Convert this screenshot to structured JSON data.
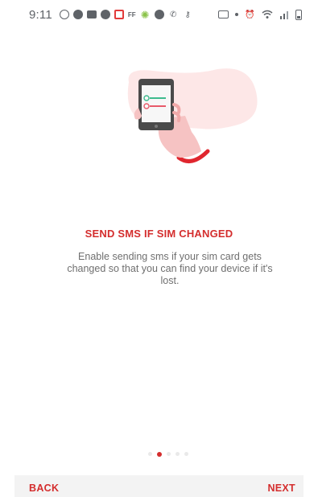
{
  "status_bar": {
    "time": "9:11",
    "left_icons": [
      "whatsapp-icon",
      "messenger-icon",
      "book-icon",
      "facebook-icon",
      "notification-square-icon",
      "ff-icon",
      "gear-icon",
      "messenger-icon-2",
      "phone-call-icon",
      "key-icon"
    ],
    "ff_text": "FF",
    "right_icons": [
      "camera-icon",
      "dot-icon",
      "alarm-icon",
      "wifi-icon",
      "signal-icon",
      "battery-icon"
    ]
  },
  "onboarding": {
    "title": "SEND SMS IF SIM CHANGED",
    "description": "Enable sending sms if your sim card gets changed so that you can find your device if it's lost."
  },
  "pager": {
    "total": 5,
    "active_index": 1
  },
  "navigation": {
    "back_label": "BACK",
    "next_label": "NEXT"
  },
  "colors": {
    "accent": "#d42d2d",
    "blob": "#fde7e7",
    "green_toggle": "#3dbb8e",
    "text_gray": "#6f6f6f",
    "bar_bg": "#f3f3f3"
  }
}
